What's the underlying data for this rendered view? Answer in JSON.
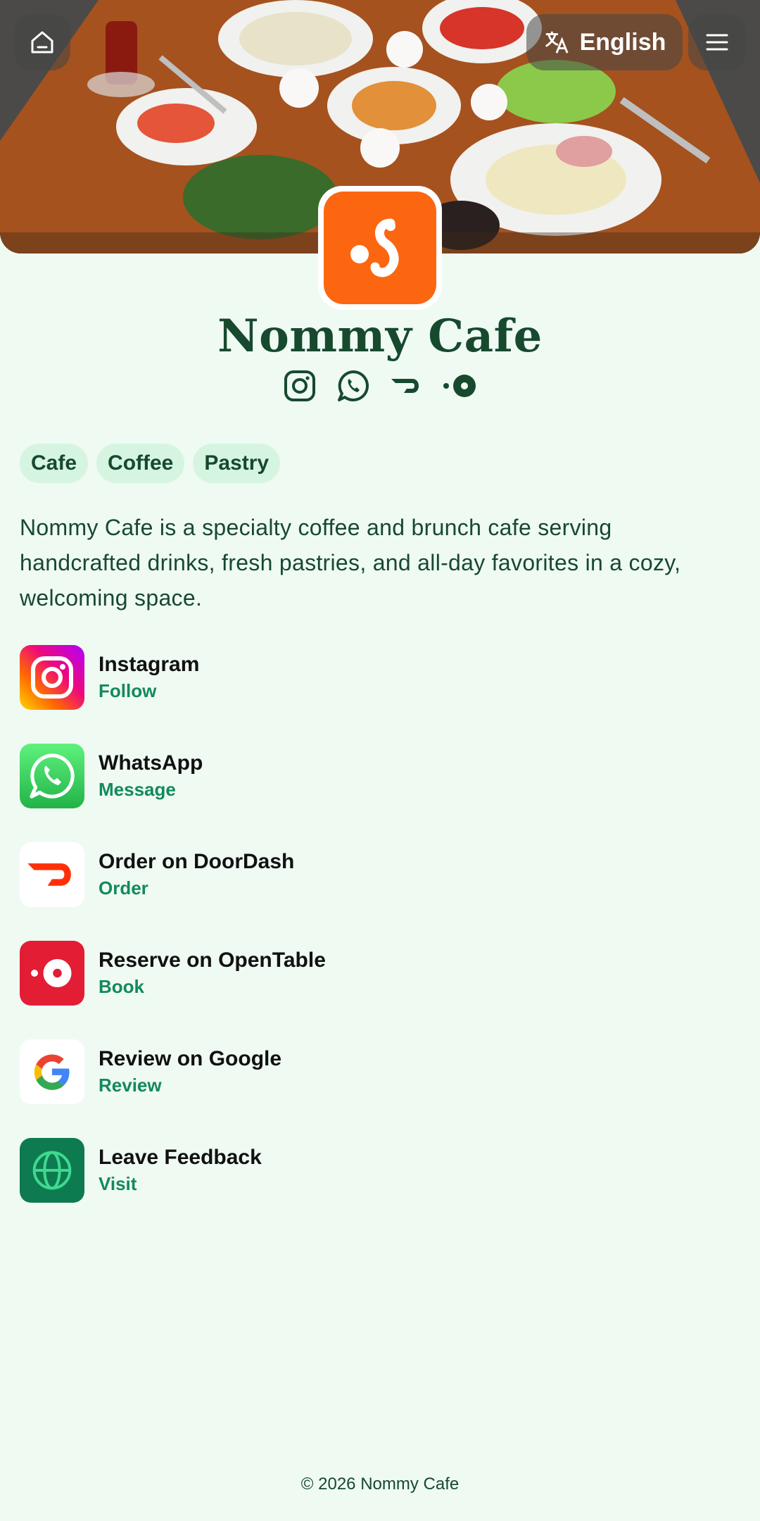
{
  "header": {
    "language_label": "English",
    "home_icon": "home-icon",
    "translate_icon": "translate-icon",
    "menu_icon": "menu-icon"
  },
  "profile": {
    "name": "Nommy Cafe",
    "logo_color": "#fc6611",
    "social_icons": [
      "instagram-icon",
      "whatsapp-icon",
      "doordash-icon",
      "opentable-icon"
    ]
  },
  "tags": [
    "Cafe",
    "Coffee",
    "Pastry"
  ],
  "description": "Nommy Cafe is a specialty coffee and brunch cafe serving handcrafted drinks, fresh pastries, and all-day favorites in a cozy, welcoming space.",
  "links": [
    {
      "title": "Instagram",
      "action": "Follow",
      "icon": "instagram-icon"
    },
    {
      "title": "WhatsApp",
      "action": "Message",
      "icon": "whatsapp-icon"
    },
    {
      "title": "Order on DoorDash",
      "action": "Order",
      "icon": "doordash-icon"
    },
    {
      "title": "Reserve on OpenTable",
      "action": "Book",
      "icon": "opentable-icon"
    },
    {
      "title": "Review on Google",
      "action": "Review",
      "icon": "google-icon"
    },
    {
      "title": "Leave Feedback",
      "action": "Visit",
      "icon": "globe-icon"
    }
  ],
  "footer": {
    "copyright": "© 2026 Nommy Cafe"
  },
  "colors": {
    "background": "#effaf3",
    "primary_text": "#17492f",
    "accent": "#138a5a",
    "tag_bg": "#d5f5e1"
  }
}
